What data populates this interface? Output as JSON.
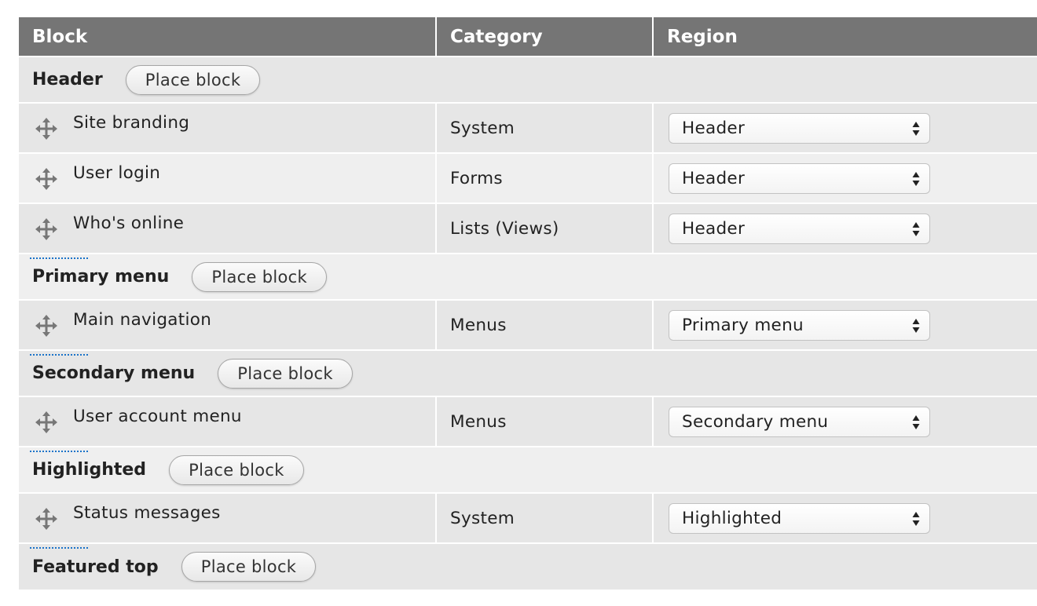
{
  "table": {
    "headers": {
      "block": "Block",
      "category": "Category",
      "region": "Region"
    },
    "place_block_label": "Place block",
    "regions": [
      {
        "title": "Header",
        "blocks": [
          {
            "label": "Site branding",
            "category": "System",
            "region": "Header"
          },
          {
            "label": "User login",
            "category": "Forms",
            "region": "Header"
          },
          {
            "label": "Who's online",
            "category": "Lists (Views)",
            "region": "Header"
          }
        ]
      },
      {
        "title": "Primary menu",
        "blocks": [
          {
            "label": "Main navigation",
            "category": "Menus",
            "region": "Primary menu"
          }
        ]
      },
      {
        "title": "Secondary menu",
        "blocks": [
          {
            "label": "User account menu",
            "category": "Menus",
            "region": "Secondary menu"
          }
        ]
      },
      {
        "title": "Highlighted",
        "blocks": [
          {
            "label": "Status messages",
            "category": "System",
            "region": "Highlighted"
          }
        ]
      },
      {
        "title": "Featured top",
        "blocks": []
      }
    ]
  },
  "icons": {
    "drag_handle": "move-arrows-icon",
    "select_arrows": "select-up-down-icon"
  },
  "colors": {
    "header_bg": "#757575",
    "row_bg": "#e6e6e6",
    "row_bg_alt": "#efefef",
    "drag_underline": "#1a73c9"
  }
}
